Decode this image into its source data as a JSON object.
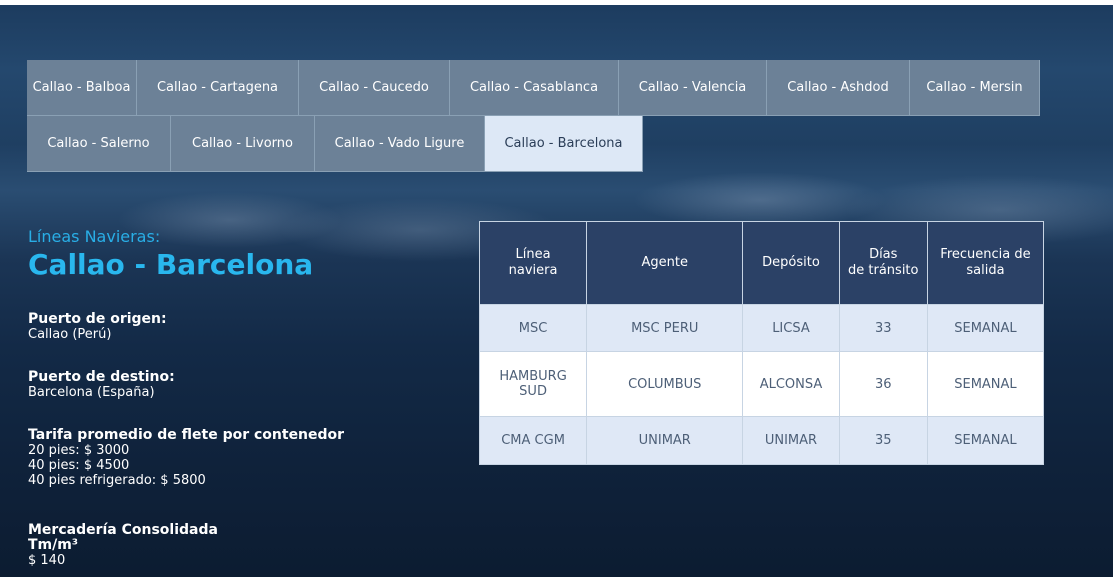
{
  "tabs": {
    "row1": [
      "Callao - Balboa",
      "Callao - Cartagena",
      "Callao - Caucedo",
      "Callao - Casablanca",
      "Callao - Valencia",
      "Callao - Ashdod",
      "Callao - Mersin"
    ],
    "row2": [
      "Callao - Salerno",
      "Callao - Livorno",
      "Callao - Vado Ligure",
      "Callao - Barcelona"
    ],
    "active": "Callao - Barcelona"
  },
  "section": {
    "subtitle": "Líneas Navieras:",
    "title": "Callao - Barcelona"
  },
  "info": {
    "origin_label": "Puerto de origen:",
    "origin_value": "Callao (Perú)",
    "dest_label": "Puerto de destino:",
    "dest_value": "Barcelona (España)",
    "freight_label": "Tarifa promedio de flete por contenedor",
    "freight_20": "20 pies: $ 3000",
    "freight_40": "40 pies: $ 4500",
    "freight_40r": "40 pies refrigerado: $ 5800",
    "consolidated_label": "Mercadería Consolidada",
    "consolidated_unit": "Tm/m³",
    "consolidated_value": "$ 140"
  },
  "table": {
    "headers": [
      [
        "Línea",
        "naviera"
      ],
      [
        "Agente"
      ],
      [
        "Depósito"
      ],
      [
        "Días",
        "de tránsito"
      ],
      [
        "Frecuencia de",
        "salida"
      ]
    ],
    "rows": [
      [
        [
          "MSC"
        ],
        [
          "MSC PERU"
        ],
        [
          "LICSA"
        ],
        [
          "33"
        ],
        [
          "SEMANAL"
        ]
      ],
      [
        [
          "HAMBURG",
          "SUD"
        ],
        [
          "COLUMBUS"
        ],
        [
          "ALCONSA"
        ],
        [
          "36"
        ],
        [
          "SEMANAL"
        ]
      ],
      [
        [
          "CMA CGM"
        ],
        [
          "UNIMAR"
        ],
        [
          "UNIMAR"
        ],
        [
          "35"
        ],
        [
          "SEMANAL"
        ]
      ]
    ]
  }
}
